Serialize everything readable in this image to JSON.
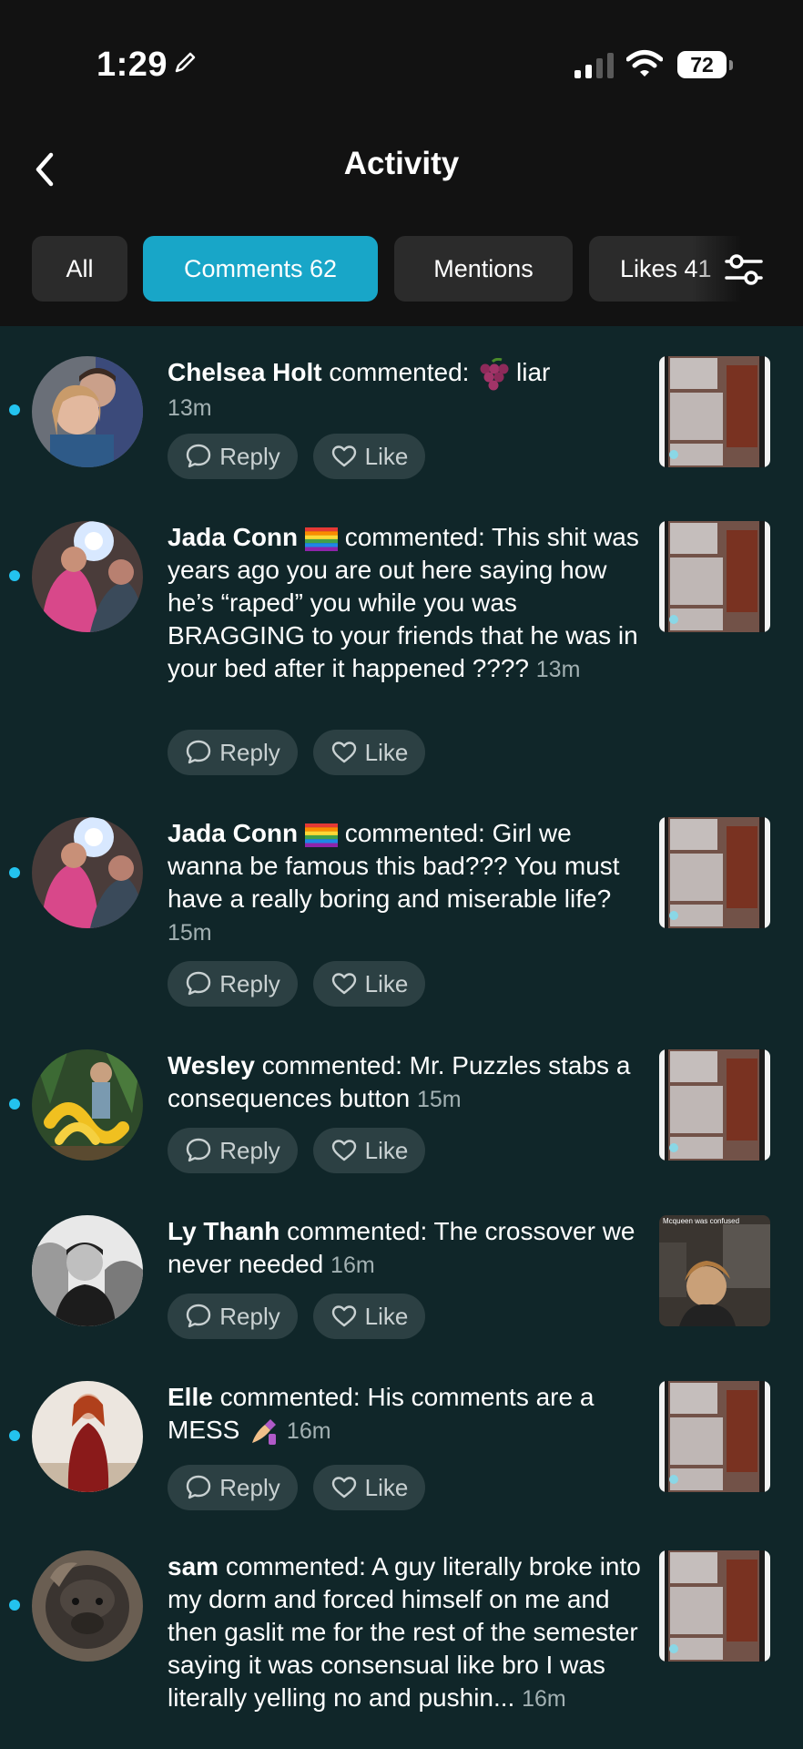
{
  "status": {
    "time": "1:29",
    "battery": "72"
  },
  "header": {
    "title": "Activity"
  },
  "tabs": [
    {
      "label": "All"
    },
    {
      "label": "Comments 62"
    },
    {
      "label": "Mentions"
    },
    {
      "label": "Likes 41"
    }
  ],
  "actions": {
    "reply": "Reply",
    "like": "Like"
  },
  "comments": [
    {
      "user": "Chelsea Holt",
      "verb": " commented: ",
      "text": " liar",
      "time": "13m",
      "emoji": "grapes"
    },
    {
      "user": "Jada Conn",
      "verb": " commented: ",
      "text": "This shit was years ago you are out here saying how he’s “raped” you while you was BRAGGING to your friends that he was in your bed after it happened ????",
      "time": "13m",
      "emoji": "rainbow-flag"
    },
    {
      "user": "Jada Conn",
      "verb": " commented: ",
      "text": "Girl we wanna be famous this bad??? You must have a really boring and miserable life?",
      "time": "15m",
      "emoji": "rainbow-flag"
    },
    {
      "user": "Wesley",
      "verb": " commented: ",
      "text": "Mr. Puzzles stabs a consequences button",
      "time": "15m"
    },
    {
      "user": "Ly Thanh",
      "verb": " commented: ",
      "text": "The crossover we never needed",
      "time": "16m"
    },
    {
      "user": "Elle",
      "verb": " commented: ",
      "text": "His comments are a MESS",
      "time": "16m",
      "emoji": "nail-polish"
    },
    {
      "user": "sam",
      "verb": " commented: ",
      "text": "A guy literally broke into my dorm and forced himself on me and then gaslit me for the rest of the semester saying it was consensual like bro I was literally yelling no and pushin...",
      "time": "16m"
    }
  ],
  "thumb_caption": "Mcqueen was confused"
}
